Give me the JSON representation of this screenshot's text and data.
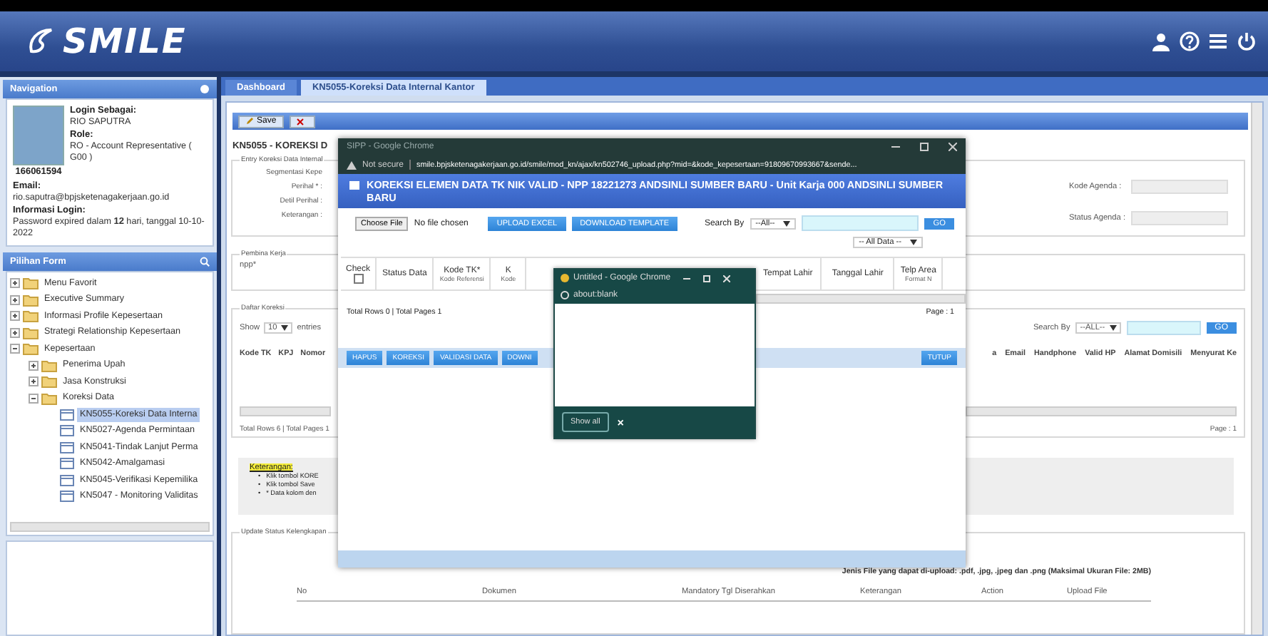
{
  "header": {
    "logo": "SMILE"
  },
  "sidebar": {
    "navigation_title": "Navigation",
    "login_label": "Login Sebagai:",
    "user_name": "RIO SAPUTRA",
    "role_label": "Role:",
    "role": "RO - Account Representative ( G00 )",
    "user_id": "166061594",
    "email_label": "Email:",
    "email": "rio.saputra@bpjsketenagakerjaan.go.id",
    "login_info_label": "Informasi Login:",
    "login_info": "Password expired dalam **12** hari, tanggal 10-10-2022",
    "form_title": "Pilihan Form",
    "tree": [
      {
        "label": "Menu Favorit",
        "kind": "folder",
        "expanded": false,
        "selected": false
      },
      {
        "label": "Executive Summary",
        "kind": "folder",
        "expanded": false,
        "selected": false
      },
      {
        "label": "Informasi Profile Kepesertaan",
        "kind": "folder",
        "expanded": false,
        "selected": false
      },
      {
        "label": "Strategi Relationship Kepesertaan",
        "kind": "folder",
        "expanded": false,
        "selected": false
      },
      {
        "label": "Kepesertaan",
        "kind": "folder",
        "expanded": true,
        "selected": false,
        "children": [
          {
            "label": "Penerima Upah",
            "kind": "folder",
            "expanded": false,
            "selected": false
          },
          {
            "label": "Jasa Konstruksi",
            "kind": "folder",
            "expanded": false,
            "selected": false
          },
          {
            "label": "Koreksi Data",
            "kind": "folder",
            "expanded": true,
            "selected": false,
            "children": [
              {
                "label": "KN5055-Koreksi Data Interna",
                "kind": "page",
                "selected": true
              },
              {
                "label": "KN5027-Agenda Permintaan",
                "kind": "page",
                "selected": false
              },
              {
                "label": "KN5041-Tindak Lanjut Perma",
                "kind": "page",
                "selected": false
              },
              {
                "label": "KN5042-Amalgamasi",
                "kind": "page",
                "selected": false
              },
              {
                "label": "KN5045-Verifikasi Kepemilika",
                "kind": "page",
                "selected": false
              },
              {
                "label": "KN5047 - Monitoring Validitas",
                "kind": "page",
                "selected": false
              }
            ]
          }
        ]
      }
    ]
  },
  "tabs": [
    {
      "label": "Dashboard",
      "selected": false
    },
    {
      "label": "KN5055-Koreksi Data Internal Kantor",
      "selected": true
    }
  ],
  "toolbar": {
    "save": "Save"
  },
  "page_title": "KN5055 - KOREKSI D",
  "entry": {
    "legend": "Entry Koreksi Data Internal",
    "labels": [
      "Segmentasi Kepe",
      "Perihal * :",
      "Detil Perihal :",
      "Keterangan :"
    ],
    "right_labels": [
      "Kode Agenda :",
      "Status Agenda :"
    ]
  },
  "pembina": {
    "legend": "Pembina Kerja",
    "label": "npp*"
  },
  "daftar": {
    "legend": "Daftar Koreksi",
    "show": "Show",
    "page_size": "10",
    "entries": "entries",
    "search_label": "Search By",
    "search_option": "--ALL--",
    "go": "GO",
    "left_columns": [
      "Kode TK",
      "KPJ",
      "Nomor"
    ],
    "right_columns": [
      "a",
      "Email",
      "Handphone",
      "Valid HP",
      "Alamat Domisili",
      "Menyurat Ke"
    ],
    "total": "Total Rows 6 | Total Pages 1",
    "page": "Page : 1"
  },
  "keterangan": {
    "title": "Keterangan:",
    "bullet": "•",
    "items": [
      "Klik tombol KORE",
      "Klik tombol Save",
      "* Data kolom den"
    ]
  },
  "update": {
    "legend": "Update Status Kelengkapan",
    "note": "Jenis File yang dapat di-upload: .pdf, .jpg, .jpeg dan .png (Maksimal Ukuran File: 2MB)",
    "columns": [
      "No",
      "Dokumen",
      "Mandatory Tgl Diserahkan",
      "Keterangan",
      "Action",
      "Upload File"
    ]
  },
  "popup": {
    "window_title": "SIPP - Google Chrome",
    "security": "Not secure",
    "url": "smile.bpjsketenagakerjaan.go.id/smile/mod_kn/ajax/kn502746_upload.php?mid=&kode_kepesertaan=91809670993667&sende...",
    "heading": "KOREKSI ELEMEN DATA TK NIK VALID - NPP 18221273 ANDSINLI SUMBER BARU - Unit Karja 000 ANDSINLI SUMBER BARU",
    "choose_file": "Choose File",
    "no_file": "No file chosen",
    "upload": "UPLOAD EXCEL",
    "download": "DOWNLOAD TEMPLATE",
    "search_label": "Search By",
    "search_option": "--All--",
    "go": "GO",
    "data_filter": "-- All Data --",
    "check_all": {
      "label": "Check",
      "checked": false
    },
    "columns": [
      {
        "label": "Status Data"
      },
      {
        "label": "Kode TK*",
        "sub": "Kode Referensi"
      },
      {
        "label": "K",
        "sub": "Kode"
      },
      {
        "label": "Tempat Lahir"
      },
      {
        "label": "Tanggal Lahir"
      },
      {
        "label": "Telp Area",
        "sub": "Format N"
      }
    ],
    "total": "Total Rows 0 | Total Pages 1",
    "page": "Page : 1",
    "actions": [
      "HAPUS",
      "KOREKSI",
      "VALIDASI DATA",
      "DOWNI"
    ],
    "close": "TUTUP"
  },
  "blank_popup": {
    "window_title": "Untitled - Google Chrome",
    "url": "about:blank",
    "show_all": "Show all",
    "dismiss": "×"
  }
}
